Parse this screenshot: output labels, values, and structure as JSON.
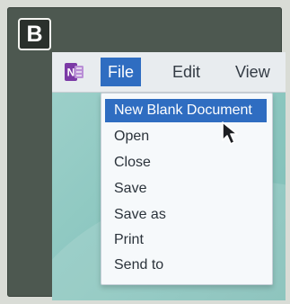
{
  "badge": {
    "label": "B"
  },
  "app": {
    "icon": "onenote-icon",
    "icon_letter": "N",
    "brand_color": "#7b3aa6"
  },
  "menubar": {
    "items": [
      {
        "label": "File",
        "state": "open"
      },
      {
        "label": "Edit",
        "state": "closed"
      },
      {
        "label": "View",
        "state": "closed"
      }
    ]
  },
  "file_menu": {
    "items": [
      {
        "label": "New Blank Document",
        "highlighted": true
      },
      {
        "label": "Open",
        "highlighted": false
      },
      {
        "label": "Close",
        "highlighted": false
      },
      {
        "label": "Save",
        "highlighted": false
      },
      {
        "label": "Save as",
        "highlighted": false
      },
      {
        "label": "Print",
        "highlighted": false
      },
      {
        "label": "Send to",
        "highlighted": false
      }
    ]
  },
  "cursor": {
    "icon": "arrow-pointer-icon"
  },
  "colors": {
    "accent": "#2f6dc1",
    "menubar_bg": "#e8ecef",
    "frame": "#4d5850",
    "desktop": "#8ec8c1"
  }
}
